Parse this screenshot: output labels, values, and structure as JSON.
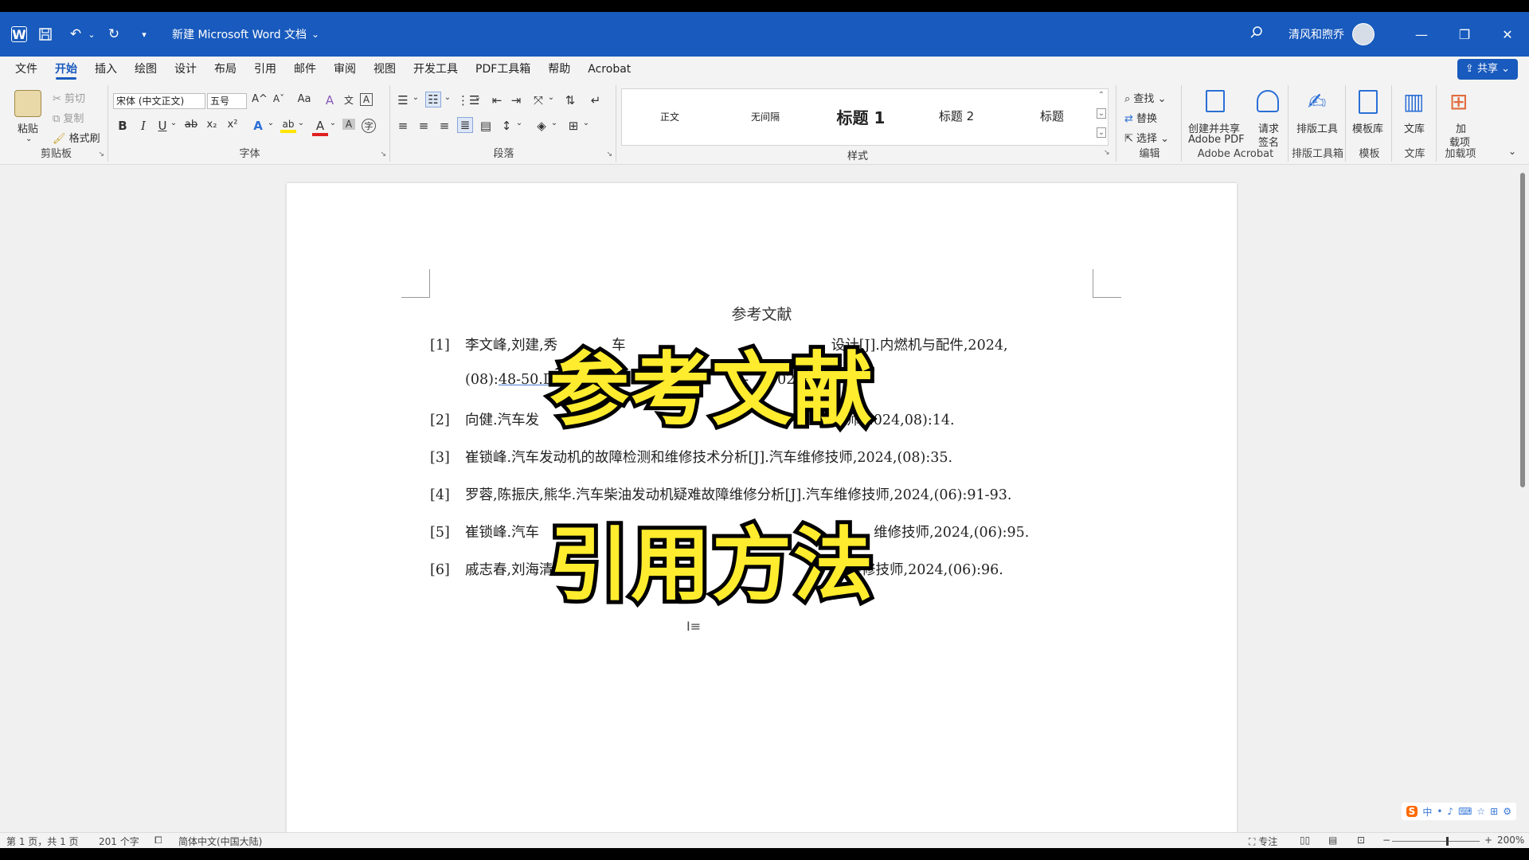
{
  "window": {
    "title": "新建 Microsoft Word 文档",
    "user": "清风和煦乔",
    "word_logo": "W",
    "icons": [
      "word-logo-icon",
      "save-icon",
      "undo-icon",
      "redo-icon",
      "customize-icon",
      "search-icon",
      "minimize-icon",
      "restore-icon",
      "close-icon"
    ],
    "minimize_glyph": "—",
    "restore_glyph": "❐",
    "close_glyph": "✕",
    "search_glyph": "⚲",
    "dropdown_glyph": "⌄"
  },
  "menu": {
    "tabs": [
      "文件",
      "开始",
      "插入",
      "绘图",
      "设计",
      "布局",
      "引用",
      "邮件",
      "审阅",
      "视图",
      "开发工具",
      "PDF工具箱",
      "帮助",
      "Acrobat"
    ],
    "active_tab": "开始",
    "share_label": "共享"
  },
  "ribbon": {
    "clipboard": {
      "paste_label": "粘贴",
      "cut_label": "剪切",
      "copy_label": "复制",
      "format_painter_label": "格式刷",
      "group_label": "剪贴板"
    },
    "font": {
      "font_name": "宋体 (中文正文)",
      "font_size": "五号",
      "bold": "B",
      "italic": "I",
      "underline": "U",
      "strike": "ab",
      "subscript": "x₂",
      "superscript": "x²",
      "grow": "A^",
      "shrink": "Aˇ",
      "case": "Aa",
      "clear": "A",
      "phonetic": "文",
      "border": "A",
      "effects": "A",
      "highlight": "ab",
      "font_color": "A",
      "shading": "A",
      "enclose": "字",
      "group_label": "字体"
    },
    "paragraph": {
      "group_label": "段落"
    },
    "styles": {
      "items": [
        "正文",
        "无间隔",
        "标题 1",
        "标题 2",
        "标题"
      ],
      "group_label": "样式"
    },
    "editing": {
      "find_label": "查找",
      "replace_label": "替换",
      "select_label": "选择",
      "group_label": "编辑"
    },
    "acrobat": {
      "create_share_label_1": "创建并共享",
      "create_share_label_2": "Adobe PDF",
      "request_sign_label_1": "请求",
      "request_sign_label_2": "签名",
      "group_label": "Adobe Acrobat"
    },
    "layout_tools": {
      "button_label": "排版工具",
      "group_label": "排版工具箱"
    },
    "templates": {
      "button_label": "模板库",
      "group_label": "模板"
    },
    "library": {
      "button_label": "文库",
      "group_label": "文库"
    },
    "addins": {
      "button_label_1": "加",
      "button_label_2": "载项",
      "group_label": "加载项"
    }
  },
  "document": {
    "heading": "参考文献",
    "references": [
      {
        "num": "[1]",
        "visible_text": "李文峰,刘建,秀",
        "mid_text": "车",
        "tail_text": "设计[J].内燃机与配件,2024,",
        "cont_a": "(08):",
        "cont_link": "48-50.D",
        "cont_b": "74-",
        "cont_c": "024"
      },
      {
        "num": "[2]",
        "visible_text": "向健.汽车发",
        "tail_text": "技师,2024,08):14."
      },
      {
        "num": "[3]",
        "visible_text": "崔锁峰.汽车发动机的故障检测和维修技术分析[J].汽车维修技师,2024,(08):35."
      },
      {
        "num": "[4]",
        "visible_text": "罗蓉,陈振庆,熊华.汽车柴油发动机疑难故障维修分析[J].汽车维修技师,2024,(06):91-93."
      },
      {
        "num": "[5]",
        "visible_text": "崔锁峰.汽车",
        "tail_text": "维修技师,2024,(06):95."
      },
      {
        "num": "[6]",
        "visible_text": "戚志春,刘海清",
        "tail_text": "维修技师,2024,(06):96."
      }
    ]
  },
  "overlay": {
    "line1": "参考文献",
    "line2": "引用方法",
    "fill_color": "#ffec2e",
    "stroke_color": "#000000"
  },
  "status": {
    "page": "第 1 页，共 1 页",
    "words": "201 个字",
    "language": "简体中文(中国大陆)",
    "focus": "专注",
    "zoom": "200%"
  },
  "ime": {
    "logo": "S",
    "items": [
      "中",
      "•",
      "♪",
      "⌨",
      "☆",
      "⊞",
      "⚙"
    ]
  },
  "colors": {
    "word_blue": "#185abd",
    "ribbon_bg": "#f3f3f3",
    "canvas_bg": "#f0f0f0"
  }
}
